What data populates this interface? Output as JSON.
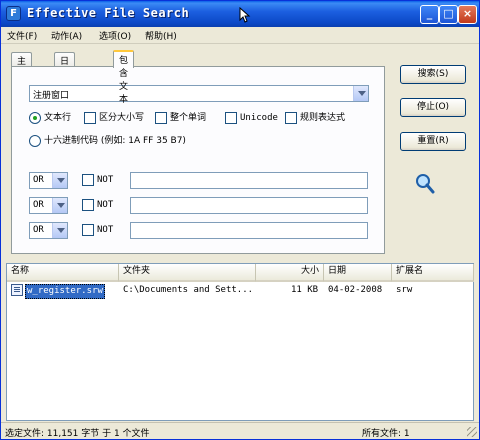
{
  "window": {
    "title": "Effective File Search",
    "app_icon_letter": "F"
  },
  "titlebar_buttons": {
    "minimize": "_",
    "maximize": "□",
    "close": "×"
  },
  "menu": [
    "文件(F)",
    "动作(A)",
    "选项(O)",
    "帮助(H)"
  ],
  "tabs": [
    "主窗口",
    "日期和大小",
    "包含文本"
  ],
  "active_tab": "包含文本",
  "text_query": {
    "value": "注册窗口"
  },
  "options": {
    "text_line": "文本行",
    "case_sensitive": "区分大小写",
    "whole_word": "整个单词",
    "unicode": "Unicode",
    "regex": "规则表达式",
    "hex": "十六进制代码 (例如: 1A FF 35 B7)"
  },
  "conditions": [
    {
      "op": "OR",
      "not_label": "NOT",
      "value": ""
    },
    {
      "op": "OR",
      "not_label": "NOT",
      "value": ""
    },
    {
      "op": "OR",
      "not_label": "NOT",
      "value": ""
    }
  ],
  "buttons": {
    "search": "搜索(S)",
    "stop": "停止(O)",
    "reset": "重置(R)"
  },
  "columns": {
    "name": "名称",
    "folder": "文件夹",
    "size": "大小",
    "date": "日期",
    "ext": "扩展名"
  },
  "results": [
    {
      "name": "w_register.srw",
      "folder": "C:\\Documents and Sett...",
      "size": "11 KB",
      "date": "04-02-2008",
      "ext": "srw"
    }
  ],
  "status": {
    "selected": "选定文件: 11,151 字节 于 1 个文件",
    "total": "所有文件: 1"
  },
  "colors": {
    "titlebar": "#0b48c6",
    "selection": "#316ac5",
    "tab_highlight": "#ffc83c"
  }
}
